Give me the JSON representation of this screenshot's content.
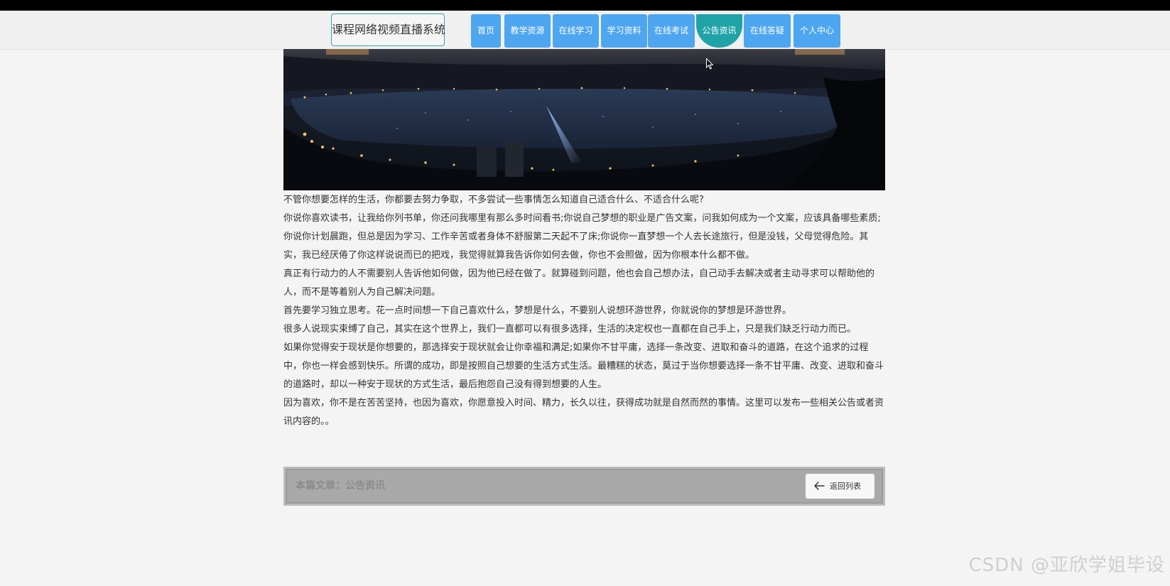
{
  "header": {
    "site_title": "课程网络视频直播系统",
    "nav": [
      {
        "label": "首页",
        "active": false
      },
      {
        "label": "教学资源",
        "active": false
      },
      {
        "label": "在线学习",
        "active": false
      },
      {
        "label": "学习资料",
        "active": false
      },
      {
        "label": "在线考试",
        "active": false
      },
      {
        "label": "公告资讯",
        "active": true
      },
      {
        "label": "在线答疑",
        "active": false
      },
      {
        "label": "个人中心",
        "active": false
      }
    ]
  },
  "article": {
    "paragraphs": [
      "不管你想要怎样的生活，你都要去努力争取，不多尝试一些事情怎么知道自己适合什么、不适合什么呢?",
      "你说你喜欢读书，让我给你列书单，你还问我哪里有那么多时间看书;你说自己梦想的职业是广告文案，问我如何成为一个文案，应该具备哪些素质;你说你计划晨跑，但总是因为学习、工作辛苦或者身体不舒服第二天起不了床;你说你一直梦想一个人去长途旅行，但是没钱，父母觉得危险。其实，我已经厌倦了你这样说说而已的把戏，我觉得就算我告诉你如何去做，你也不会照做，因为你根本什么都不做。",
      "真正有行动力的人不需要别人告诉他如何做，因为他已经在做了。就算碰到问题，他也会自己想办法，自己动手去解决或者主动寻求可以帮助他的人，而不是等着别人为自己解决问题。",
      "首先要学习独立思考。花一点时间想一下自己喜欢什么，梦想是什么，不要别人说想环游世界，你就说你的梦想是环游世界。",
      "很多人说现实束缚了自己，其实在这个世界上，我们一直都可以有很多选择，生活的决定权也一直都在自己手上，只是我们缺乏行动力而已。",
      "如果你觉得安于现状是你想要的，那选择安于现状就会让你幸福和满足;如果你不甘平庸，选择一条改变、进取和奋斗的道路，在这个追求的过程中，你也一样会感到快乐。所谓的成功，即是按照自己想要的生活方式生活。最糟糕的状态，莫过于当你想要选择一条不甘平庸、改变、进取和奋斗的道路时，却以一种安于现状的方式生活，最后抱怨自己没有得到想要的人生。",
      "因为喜欢，你不是在苦苦坚持，也因为喜欢，你愿意投入时间、精力，长久以往，获得成功就是自然而然的事情。这里可以发布一些相关公告或者资讯内容的。。"
    ]
  },
  "footer": {
    "article_label": "本篇文章：公告资讯",
    "back_label": "返回列表",
    "back_icon": "arrow-left-icon"
  },
  "watermark": "CSDN @亚欣学姐毕设",
  "colors": {
    "nav_blue": "#4ea6f0",
    "nav_active": "#1fa3a8",
    "brand_border": "#33a3b0"
  }
}
